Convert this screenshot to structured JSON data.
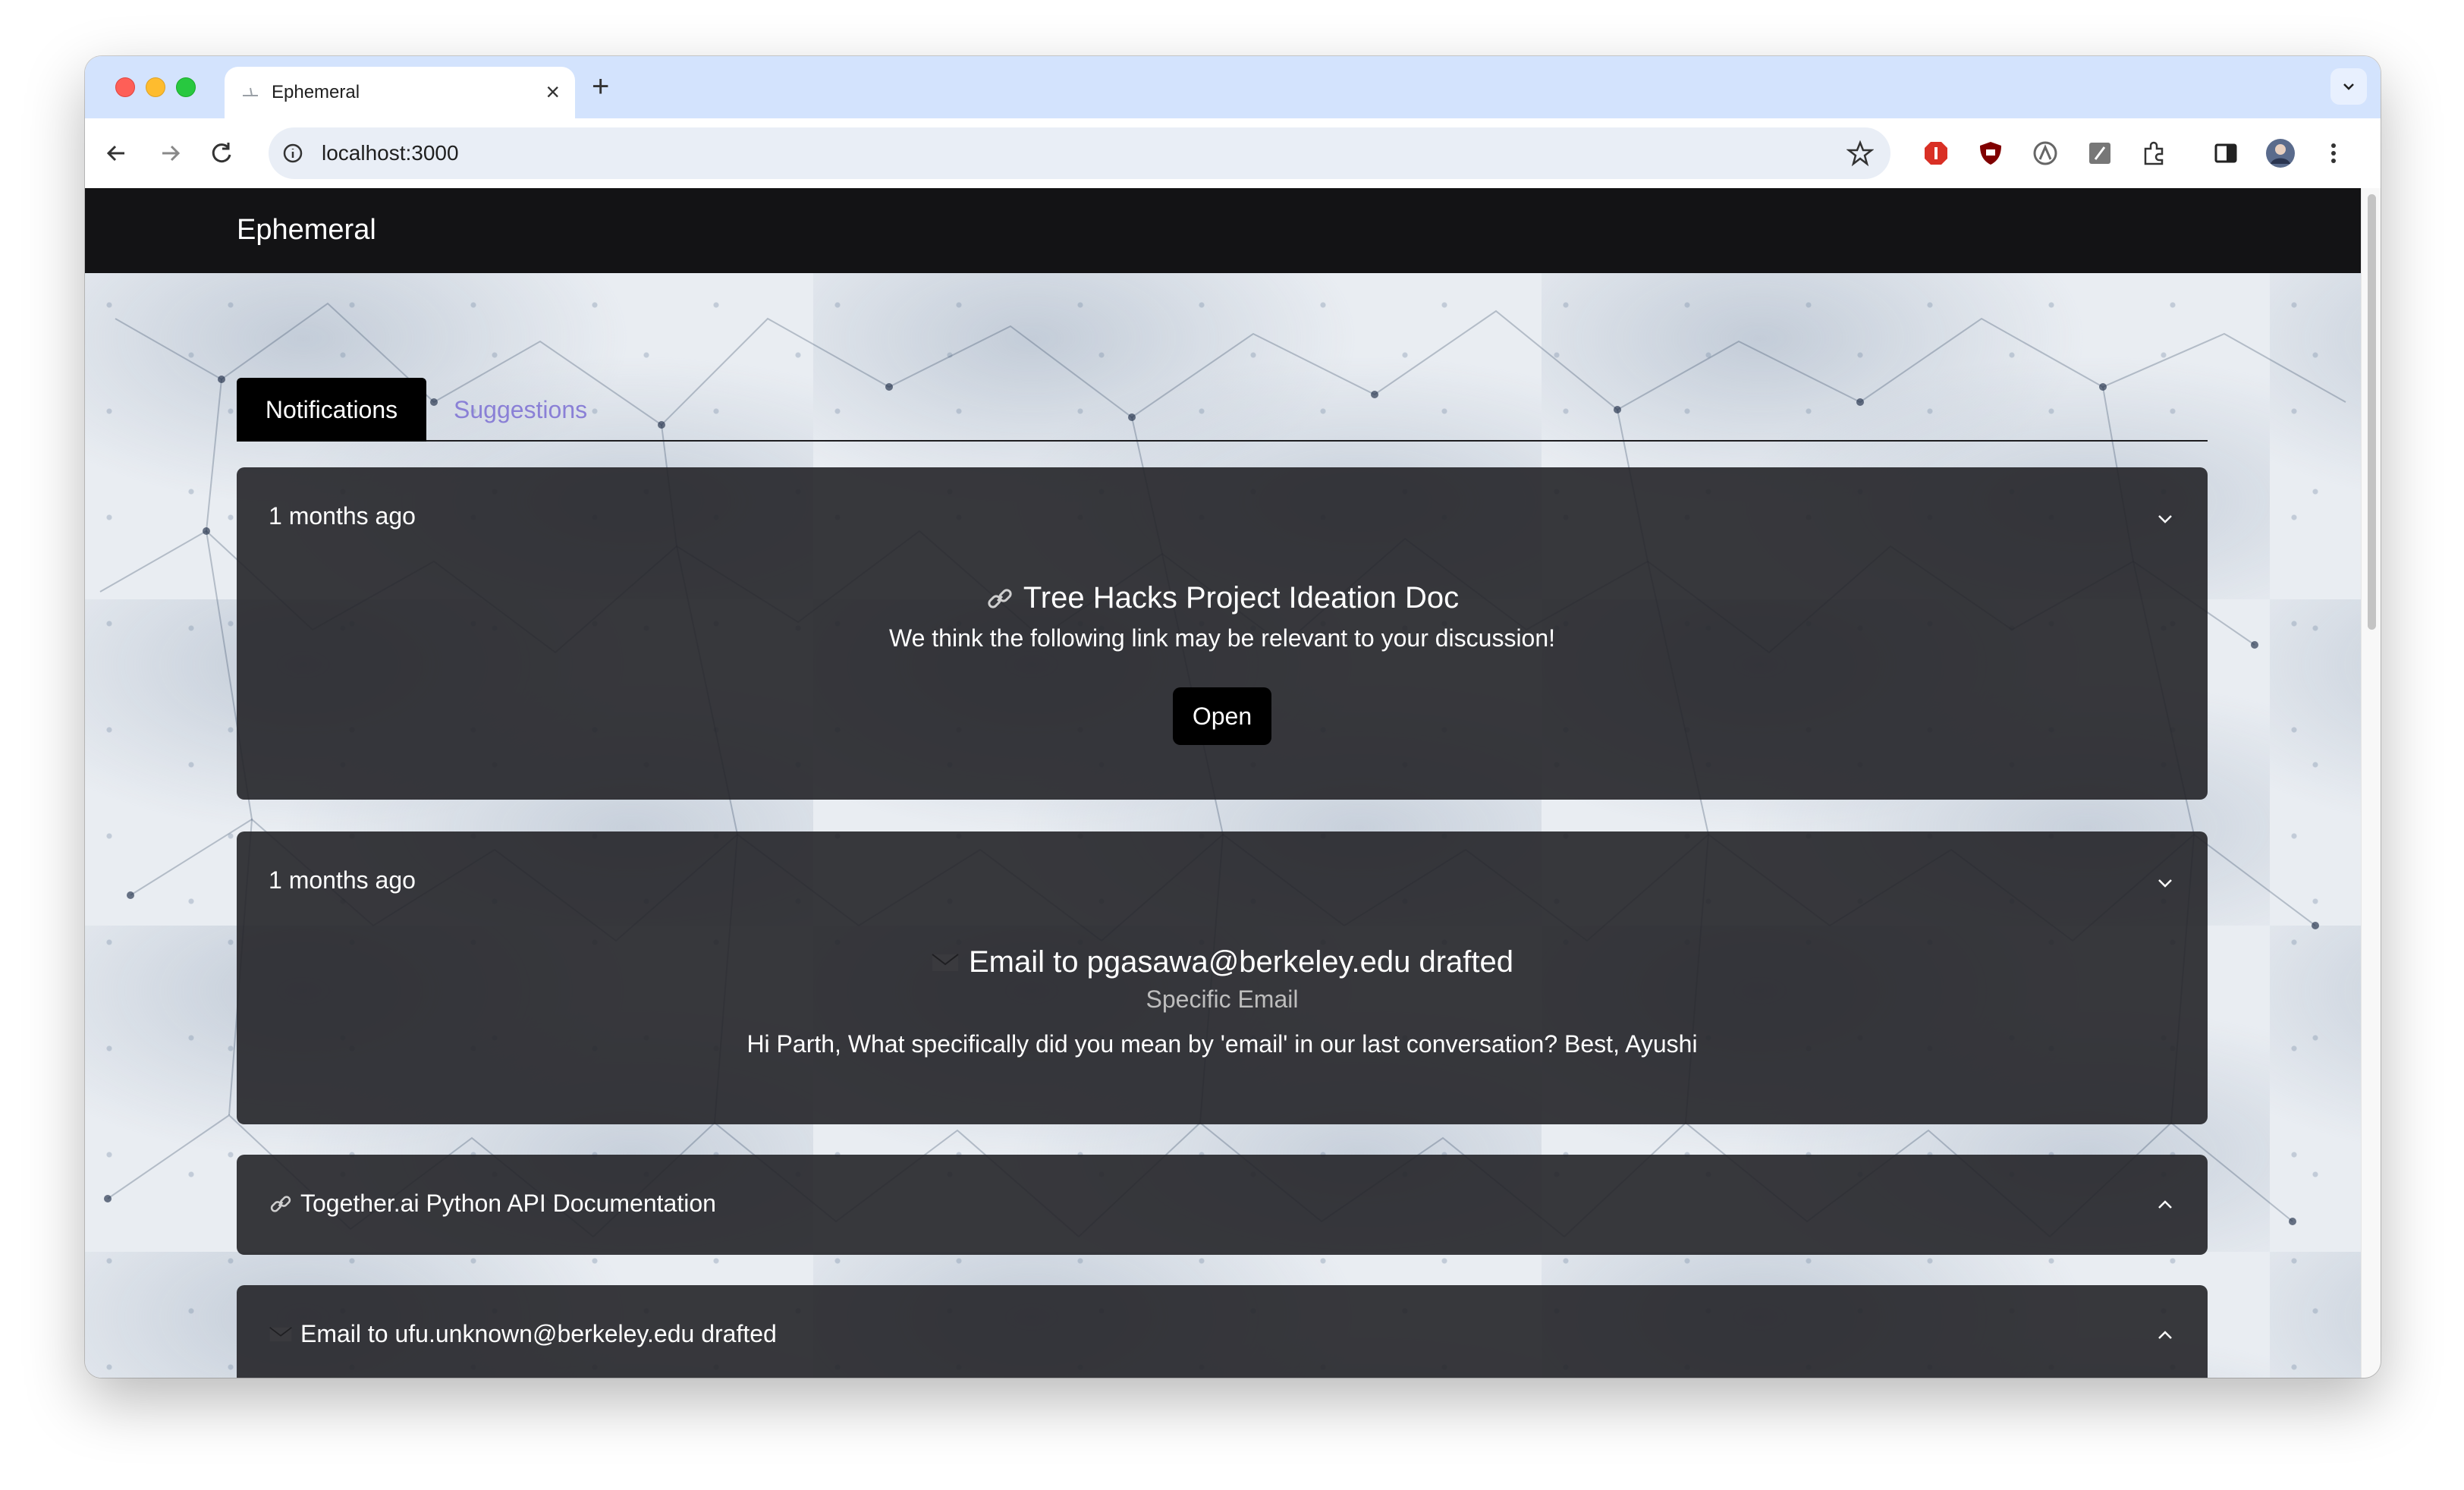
{
  "browser": {
    "tab_title": "Ephemeral",
    "new_tab_symbol": "+",
    "close_symbol": "×",
    "url": "localhost:3000"
  },
  "app": {
    "brand": "Ephemeral",
    "tabs": [
      {
        "label": "Notifications",
        "active": true
      },
      {
        "label": "Suggestions",
        "active": false
      }
    ]
  },
  "notifications": [
    {
      "time": "1 months ago",
      "icon": "link-icon",
      "title": "Tree Hacks Project Ideation Doc",
      "description": "We think the following link may be relevant to your discussion!",
      "button": "Open",
      "expanded": true
    },
    {
      "time": "1 months ago",
      "icon": "envelope-icon",
      "title": "Email to pgasawa@berkeley.edu drafted",
      "subtitle": "Specific Email",
      "body": "Hi Parth, What specifically did you mean by 'email' in our last conversation? Best, Ayushi",
      "expanded": true
    },
    {
      "icon": "link-icon",
      "title": "Together.ai Python API Documentation",
      "expanded": false
    },
    {
      "icon": "envelope-icon",
      "title": "Email to ufu.unknown@berkeley.edu drafted",
      "expanded": false
    }
  ],
  "colors": {
    "appbar": "#131315",
    "card": "#242428",
    "tab_active": "#000000",
    "tab_inactive_text": "#8a80d6"
  }
}
